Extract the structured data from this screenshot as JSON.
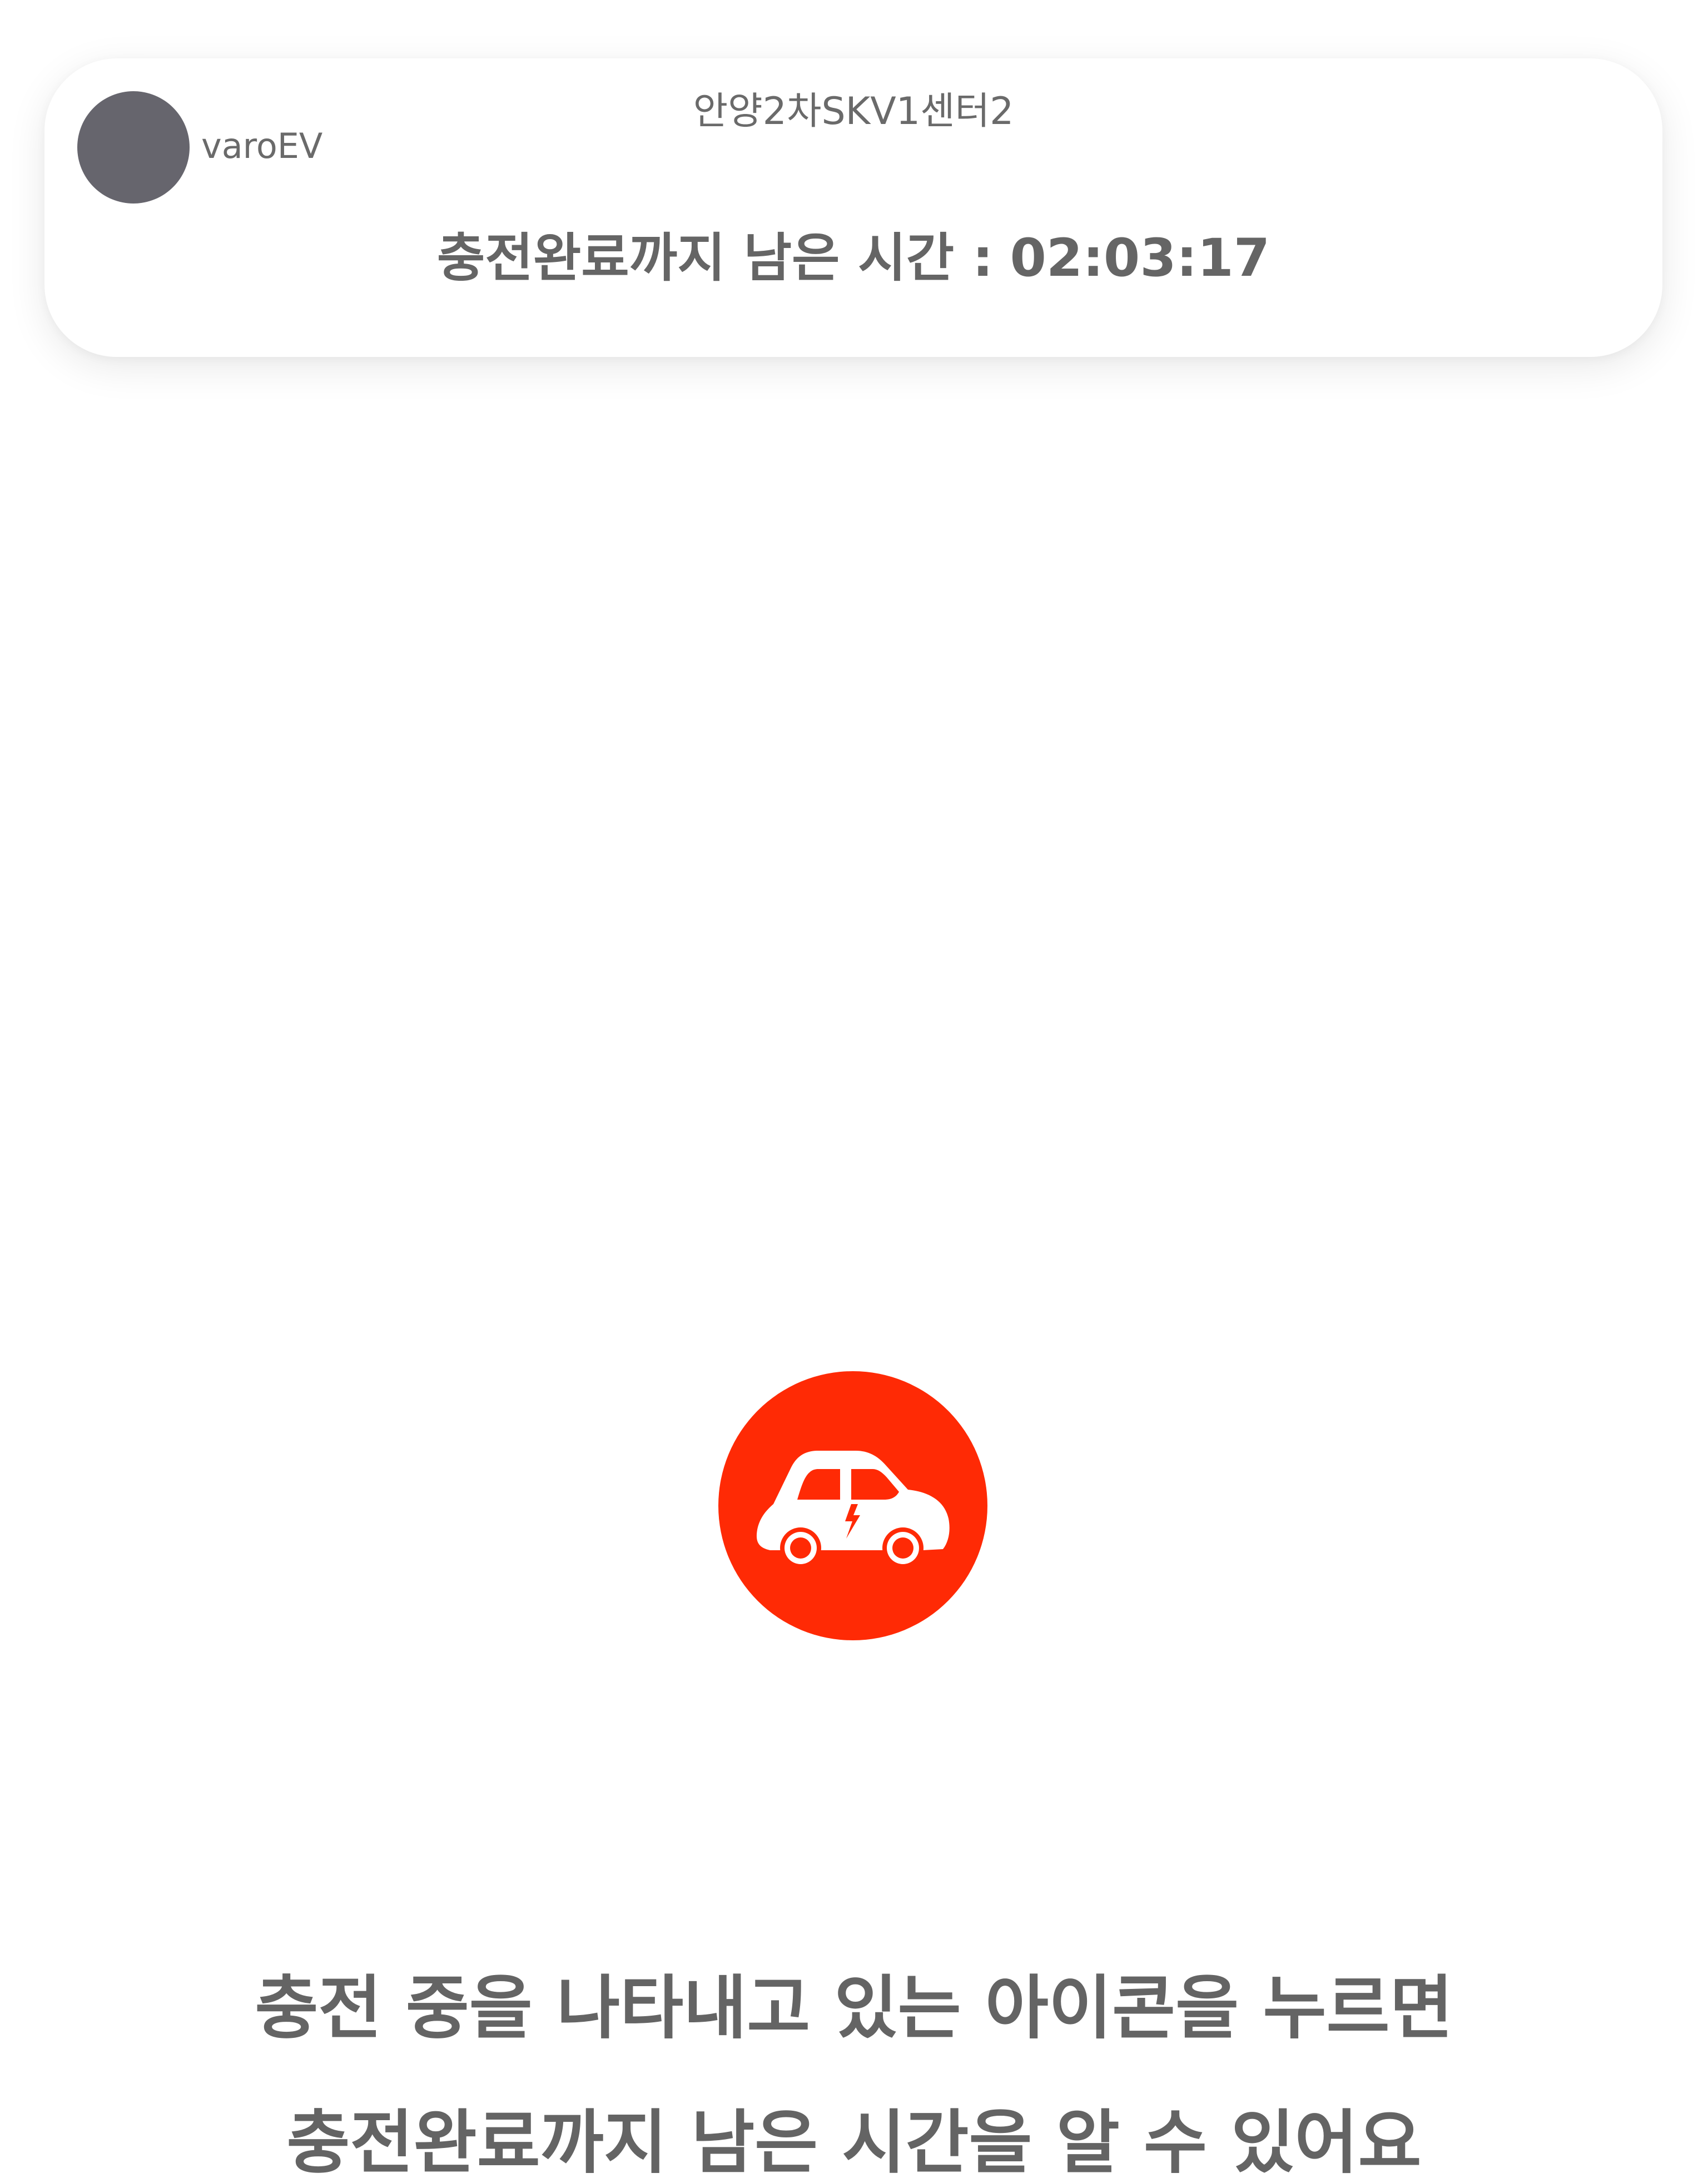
{
  "header_card": {
    "brand": "varoEV",
    "station": "안양2차SKV1센터2",
    "remaining_label": "충전완료까지 남은 시간 :",
    "remaining_value": "02:03:17"
  },
  "charging_button": {
    "icon": "electric-car-icon",
    "color": "#ff2a05"
  },
  "guide": {
    "line1": "충전 중을 나타내고 있는 아이콘을 누르면",
    "line2": "충전완료까지 남은 시간을 알 수 있어요"
  },
  "colors": {
    "avatar": "#66656d",
    "text": "#666666",
    "accent": "#ff2a05"
  }
}
